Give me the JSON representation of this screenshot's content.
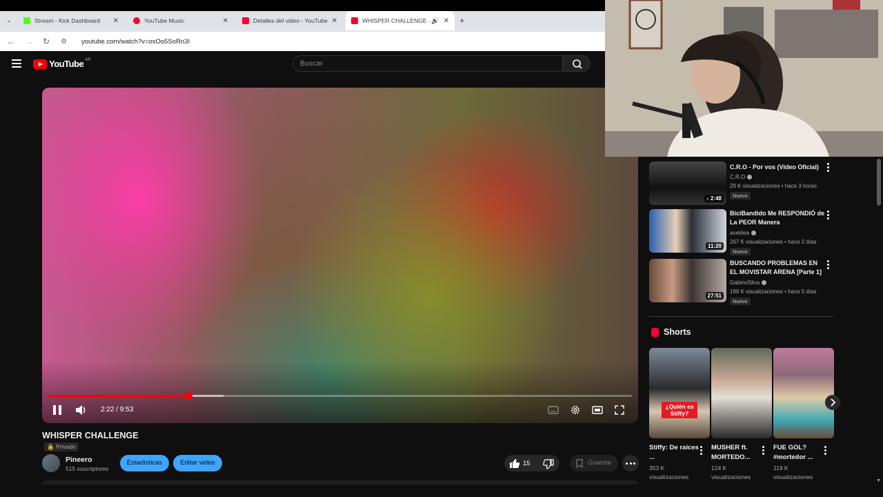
{
  "browser": {
    "tabs": [
      {
        "label": "Stream - Kick Dashboard",
        "color": "#53fc18"
      },
      {
        "label": "YouTube Music",
        "color": "#ff0033"
      },
      {
        "label": "Detalles del video - YouTube Studio",
        "color": "#ff0033"
      },
      {
        "label": "WHISPER CHALLENGE - YouTube",
        "color": "#ff0033"
      }
    ],
    "url": "youtube.com/watch?v=osOo5SoRn3I"
  },
  "header": {
    "logo_text": "YouTube",
    "region": "AR",
    "search_placeholder": "Buscar"
  },
  "player": {
    "time": "2:22 / 9:53",
    "progress": 0.24,
    "buffered": 0.3
  },
  "video": {
    "title": "WHISPER CHALLENGE",
    "privacy": "Privado",
    "channel": "Pineero",
    "subscribers": "515 suscriptores",
    "stats_label": "Estadísticas",
    "edit_label": "Editar video",
    "likes": "15",
    "save_label": "Guardar"
  },
  "sidebar": {
    "related": [
      {
        "title": "C.R.O - Por vos (Video Oficial)",
        "channel": "C.R.O",
        "meta": "29 K visualizaciones • hace 3 horas",
        "badge": "Nuevo",
        "duration": "2:48"
      },
      {
        "title": "BiciBandido Me RESPONDIÓ de La PEOR Manera",
        "channel": "axeldea",
        "meta": "267 K visualizaciones • hace 2 días",
        "badge": "Nuevo",
        "duration": "11:20"
      },
      {
        "title": "BUSCANDO PROBLEMAS EN EL MOVISTAR ARENA [Parte 1]",
        "channel": "GabinoSilva",
        "meta": "199 K visualizaciones • hace 5 días",
        "badge": "Nuevo",
        "duration": "27:51"
      }
    ],
    "shorts_title": "Shorts",
    "shorts": [
      {
        "title": "Stiffy: De raíces ...",
        "views": "353 K visualizaciones",
        "overlay": "¿Quién es Stiffy?"
      },
      {
        "title": "MUSHER ft. MORTEDO...",
        "views": "124 K visualizaciones",
        "overlay": ""
      },
      {
        "title": "FUE GOL? #mortedor ...",
        "views": "119 K visualizaciones",
        "overlay": ""
      }
    ]
  },
  "colors": {
    "accent": "#ff0000",
    "button": "#3ea6ff",
    "bg": "#0f0f0f"
  }
}
